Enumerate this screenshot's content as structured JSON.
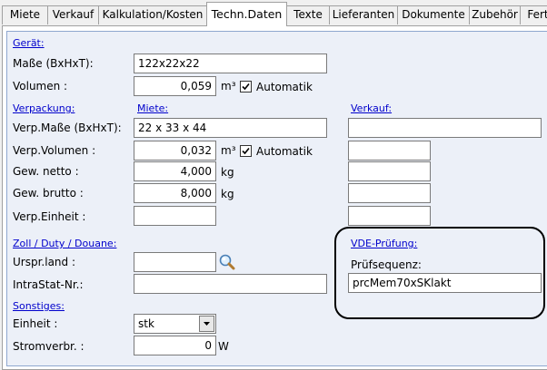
{
  "tabs": [
    "Miete",
    "Verkauf",
    "Kalkulation/Kosten",
    "Techn.Daten",
    "Texte",
    "Lieferanten",
    "Dokumente",
    "Zubehör",
    "Fert"
  ],
  "geraet": {
    "section": "Gerät:",
    "masse_label": "Maße (BxHxT):",
    "masse_value": "122x22x22",
    "volumen_label": "Volumen :",
    "volumen_value": "0,059",
    "volumen_unit": "m³",
    "automatik_label": "Automatik"
  },
  "verpackung": {
    "section": "Verpackung:",
    "miete_header": "Miete:",
    "verkauf_header": "Verkauf:",
    "masse_label": "Verp.Maße (BxHxT):",
    "masse_value": "22 x 33 x 44",
    "volumen_label": "Verp.Volumen :",
    "volumen_value": "0,032",
    "volumen_unit": "m³",
    "automatik_label": "Automatik",
    "netto_label": "Gew. netto :",
    "netto_value": "4,000",
    "netto_unit": "kg",
    "brutto_label": "Gew. brutto :",
    "brutto_value": "8,000",
    "brutto_unit": "kg",
    "einheit_label": "Verp.Einheit :",
    "einheit_value": ""
  },
  "zoll": {
    "section": "Zoll / Duty / Douane:",
    "ursprland_label": "Urspr.land :",
    "ursprland_value": "",
    "intrastat_label": "IntraStat-Nr.:",
    "intrastat_value": ""
  },
  "vde": {
    "section": "VDE-Prüfung:",
    "pruefsequenz_label": "Prüfsequenz:",
    "pruefsequenz_value": "prcMem70xSKlakt"
  },
  "sonstiges": {
    "section": "Sonstiges:",
    "einheit_label": "Einheit :",
    "einheit_value": "stk",
    "stromverbr_label": "Stromverbr. :",
    "stromverbr_value": "0",
    "stromverbr_unit": "W"
  },
  "colors": {
    "section_link": "#0000cc",
    "group_bg": "#ecf0f8",
    "group_border": "#8fa7cf"
  }
}
